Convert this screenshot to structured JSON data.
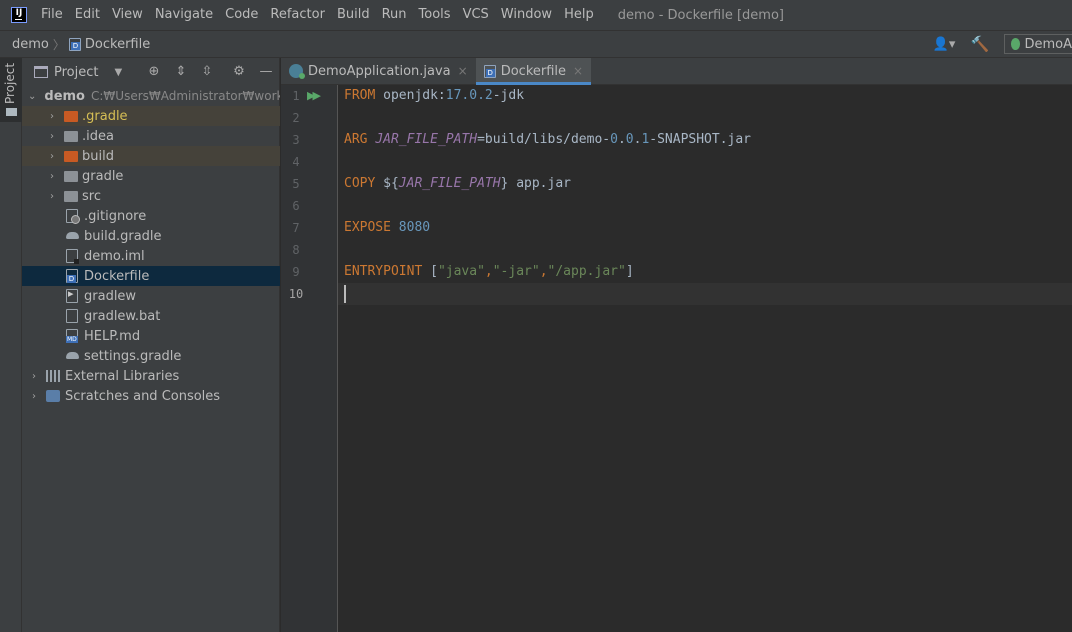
{
  "menubar": {
    "logo_text": "IJ",
    "items": [
      "File",
      "Edit",
      "View",
      "Navigate",
      "Code",
      "Refactor",
      "Build",
      "Run",
      "Tools",
      "VCS",
      "Window",
      "Help"
    ],
    "window_title": "demo - Dockerfile [demo]"
  },
  "navbar": {
    "project": "demo",
    "separator": "〉",
    "file": "Dockerfile",
    "run_config": "DemoA"
  },
  "left_stripe": {
    "project_label": "Project"
  },
  "project_panel": {
    "title": "Project",
    "tree": {
      "root": {
        "label": "demo",
        "path": "C:₩Users₩Administrator₩worksp"
      },
      "items": [
        {
          "label": ".gradle",
          "kind": "folder-orange"
        },
        {
          "label": ".idea",
          "kind": "folder"
        },
        {
          "label": "build",
          "kind": "folder-orange"
        },
        {
          "label": "gradle",
          "kind": "folder"
        },
        {
          "label": "src",
          "kind": "folder"
        },
        {
          "label": ".gitignore",
          "kind": "file-git"
        },
        {
          "label": "build.gradle",
          "kind": "file-gradle"
        },
        {
          "label": "demo.iml",
          "kind": "file-iml"
        },
        {
          "label": "Dockerfile",
          "kind": "file-docker"
        },
        {
          "label": "gradlew",
          "kind": "file-shell"
        },
        {
          "label": "gradlew.bat",
          "kind": "file"
        },
        {
          "label": "HELP.md",
          "kind": "file-md"
        },
        {
          "label": "settings.gradle",
          "kind": "file-gradle"
        }
      ],
      "external_libraries": "External Libraries",
      "scratches": "Scratches and Consoles"
    }
  },
  "tabs": [
    {
      "label": "DemoApplication.java",
      "active": false,
      "close": "×"
    },
    {
      "label": "Dockerfile",
      "active": true,
      "close": "×"
    }
  ],
  "editor": {
    "line_numbers": [
      "1",
      "2",
      "3",
      "4",
      "5",
      "6",
      "7",
      "8",
      "9",
      "10"
    ],
    "current_line": 10,
    "code": {
      "l1": {
        "kw": "FROM",
        "rest_a": " openjdk:",
        "num": "17.0.2",
        "rest_b": "-jdk"
      },
      "l3": {
        "kw": "ARG",
        "var": "JAR_FILE_PATH",
        "rest_a": "=build/libs/demo-",
        "num_a": "0",
        "dot1": ".",
        "num_b": "0",
        "dot2": ".",
        "num_c": "1",
        "rest_b": "-SNAPSHOT.jar"
      },
      "l5": {
        "kw": "COPY",
        "pre": " ${",
        "var": "JAR_FILE_PATH",
        "post": "} app.jar"
      },
      "l7": {
        "kw": "EXPOSE",
        "num": "8080"
      },
      "l9": {
        "kw": "ENTRYPOINT",
        "open": " [",
        "s1": "\"java\"",
        "c1": ",",
        "s2": "\"-jar\"",
        "c2": ",",
        "s3": "\"/app.jar\"",
        "close": "]"
      }
    }
  },
  "colors": {
    "keyword": "#cc7832",
    "variable": "#9876aa",
    "number": "#6897bb",
    "string": "#6a8759",
    "selection": "#0d293e",
    "tab_underline": "#4a88c7"
  }
}
